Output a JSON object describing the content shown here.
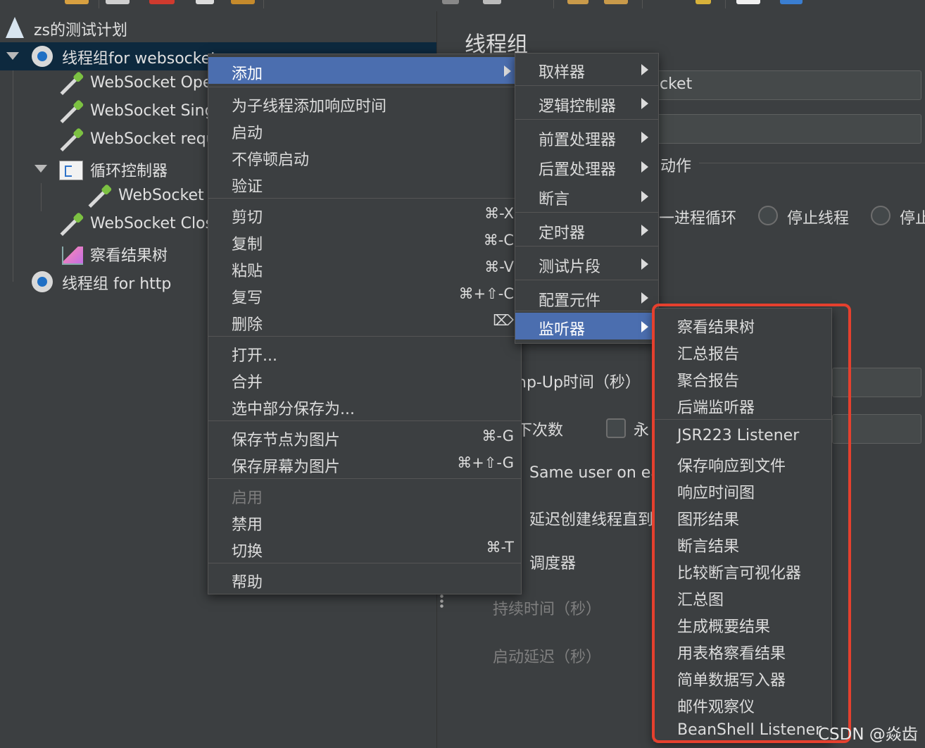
{
  "tree": {
    "items": [
      {
        "label": "zs的测试计划"
      },
      {
        "label": "线程组for websocket"
      },
      {
        "label": "WebSocket Open Connection"
      },
      {
        "label": "WebSocket Single Write Sampler"
      },
      {
        "label": "WebSocket request-response Sampler"
      },
      {
        "label": "循环控制器"
      },
      {
        "label": "WebSocket Single Read Sampler"
      },
      {
        "label": "WebSocket Close"
      },
      {
        "label": "察看结果树"
      },
      {
        "label": "线程组 for http"
      }
    ]
  },
  "panel": {
    "title": "线程组",
    "name_value_tail": "cket",
    "action_label_tail": "动作",
    "radio_loop_tail": "一进程循环",
    "radio_stop_thread": "停止线程",
    "radio_stop_test_tail": "停止",
    "rampup_label_tail": "np-Up时间（秒）",
    "loop_count_tail": "下次数",
    "forever_tail": "永",
    "same_user_tail": "Same user on ea",
    "delay_create_tail": "延迟创建线程直到",
    "scheduler_label": "调度器",
    "duration_label": "持续时间（秒）",
    "startup_delay_label": "启动延迟（秒）"
  },
  "context_menu": {
    "items": [
      {
        "label": "添加",
        "shortcut": ""
      },
      {
        "label": "为子线程添加响应时间",
        "shortcut": ""
      },
      {
        "label": "启动",
        "shortcut": ""
      },
      {
        "label": "不停顿启动",
        "shortcut": ""
      },
      {
        "label": "验证",
        "shortcut": ""
      },
      {
        "label": "剪切",
        "shortcut": "⌘-X"
      },
      {
        "label": "复制",
        "shortcut": "⌘-C"
      },
      {
        "label": "粘贴",
        "shortcut": "⌘-V"
      },
      {
        "label": "复写",
        "shortcut": "⌘+⇧-C"
      },
      {
        "label": "删除",
        "shortcut": "⌦"
      },
      {
        "label": "打开...",
        "shortcut": ""
      },
      {
        "label": "合并",
        "shortcut": ""
      },
      {
        "label": "选中部分保存为...",
        "shortcut": ""
      },
      {
        "label": "保存节点为图片",
        "shortcut": "⌘-G"
      },
      {
        "label": "保存屏幕为图片",
        "shortcut": "⌘+⇧-G"
      },
      {
        "label": "启用",
        "shortcut": ""
      },
      {
        "label": "禁用",
        "shortcut": ""
      },
      {
        "label": "切换",
        "shortcut": "⌘-T"
      },
      {
        "label": "帮助",
        "shortcut": ""
      }
    ]
  },
  "add_submenu": {
    "items": [
      {
        "label": "取样器"
      },
      {
        "label": "逻辑控制器"
      },
      {
        "label": "前置处理器"
      },
      {
        "label": "后置处理器"
      },
      {
        "label": "断言"
      },
      {
        "label": "定时器"
      },
      {
        "label": "测试片段"
      },
      {
        "label": "配置元件"
      },
      {
        "label": "监听器"
      }
    ]
  },
  "listener_submenu": {
    "items": [
      {
        "label": "察看结果树"
      },
      {
        "label": "汇总报告"
      },
      {
        "label": "聚合报告"
      },
      {
        "label": "后端监听器"
      },
      {
        "label": "JSR223 Listener"
      },
      {
        "label": "保存响应到文件"
      },
      {
        "label": "响应时间图"
      },
      {
        "label": "图形结果"
      },
      {
        "label": "断言结果"
      },
      {
        "label": "比较断言可视化器"
      },
      {
        "label": "汇总图"
      },
      {
        "label": "生成概要结果"
      },
      {
        "label": "用表格察看结果"
      },
      {
        "label": "简单数据写入器"
      },
      {
        "label": "邮件观察仪"
      },
      {
        "label": "BeanShell Listener"
      }
    ]
  },
  "watermark": "CSDN @焱齿",
  "colors": {
    "background": "#3c3f41",
    "selection": "#4b6eaf",
    "tree_selection": "#0d293e",
    "highlight_box": "#e5402e"
  }
}
